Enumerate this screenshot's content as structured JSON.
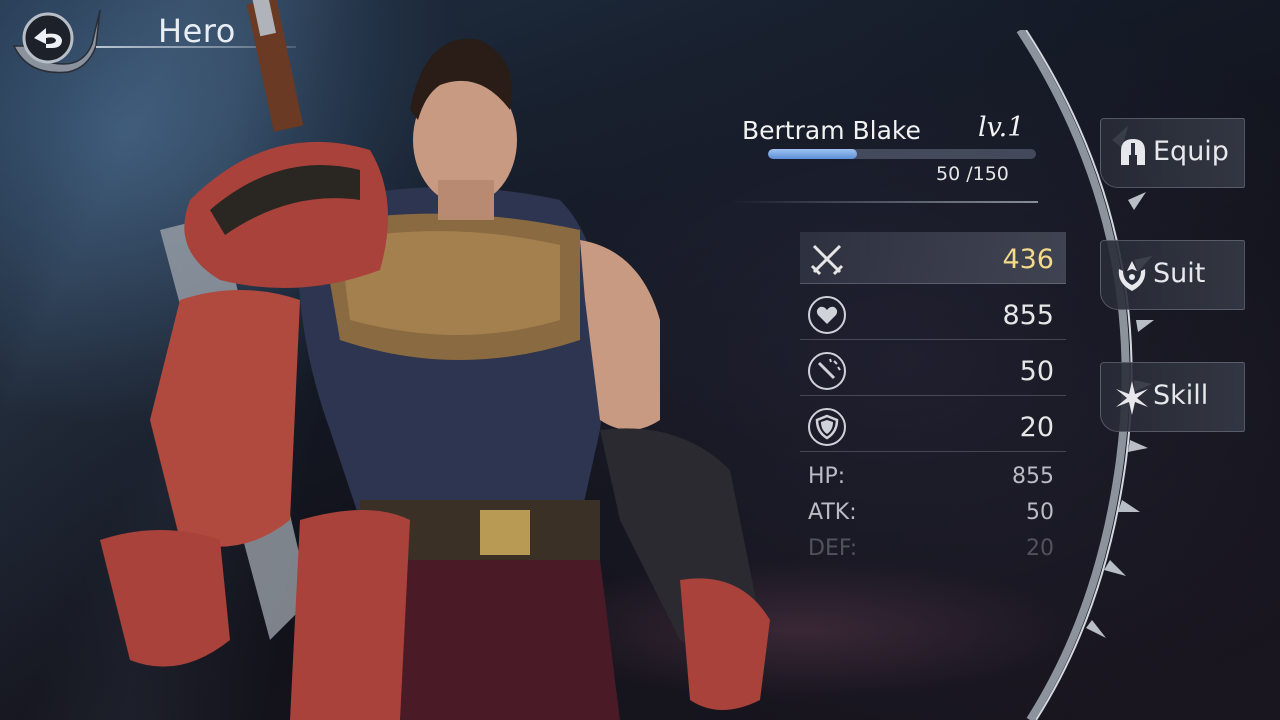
{
  "header": {
    "title": "Hero"
  },
  "hero": {
    "name": "Bertram Blake",
    "level": "lv.1",
    "xp_text": "50 /150",
    "xp_progress": 0.333
  },
  "stats": [
    {
      "icon": "crossed-swords-icon",
      "value": "436",
      "highlighted": true
    },
    {
      "icon": "heart-icon",
      "value": "855"
    },
    {
      "icon": "sword-impact-icon",
      "value": "50"
    },
    {
      "icon": "shield-icon",
      "value": "20"
    }
  ],
  "details": [
    {
      "label": "HP:",
      "value": "855"
    },
    {
      "label": "ATK:",
      "value": "50"
    },
    {
      "label": "DEF:",
      "value": "20"
    }
  ],
  "tabs": [
    {
      "label": "Equip",
      "icon": "helmet-icon"
    },
    {
      "label": "Suit",
      "icon": "suit-emblem-icon"
    },
    {
      "label": "Skill",
      "icon": "spark-icon"
    }
  ],
  "colors": {
    "accent_gold": "#f3d98a",
    "xp_blue": "#5c8fd6"
  }
}
